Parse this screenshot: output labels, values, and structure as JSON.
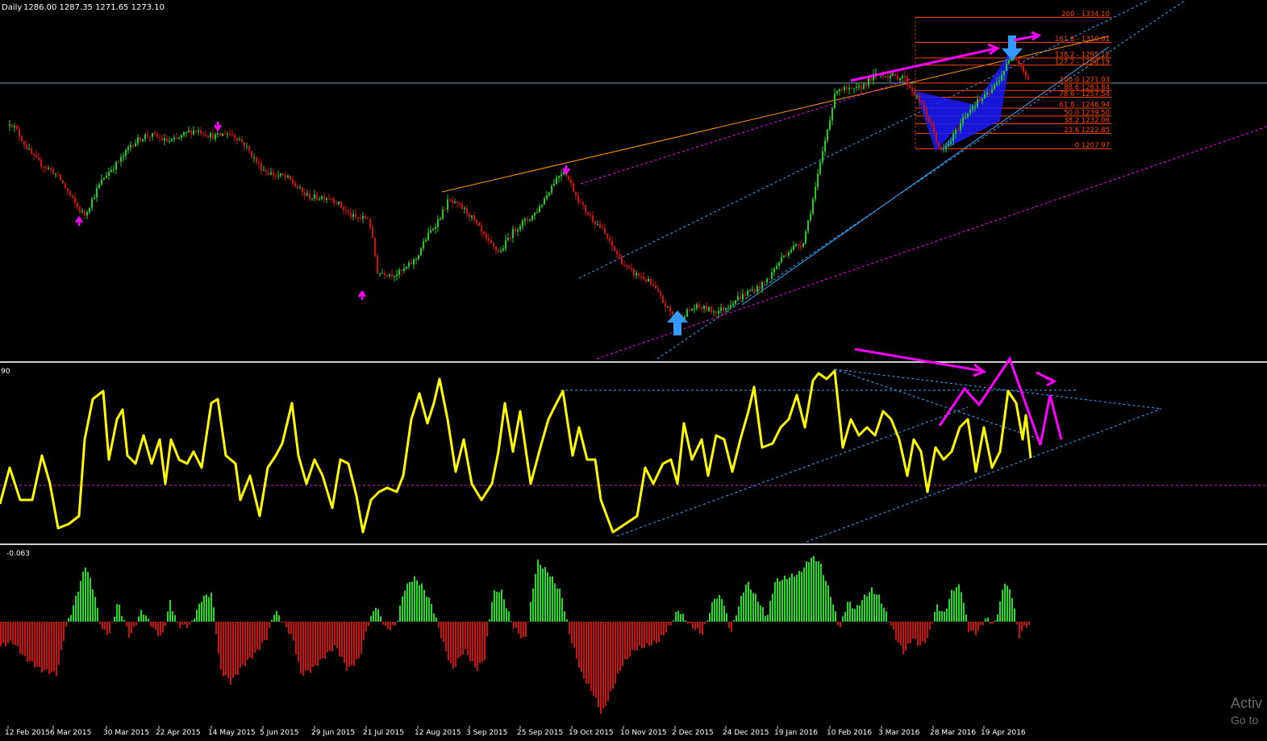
{
  "header": {
    "timeframe": "Daily",
    "ohlc": "1286.00 1287.35 1271.65 1273.10"
  },
  "oscillator_level": "90",
  "histogram_value": "-0.063",
  "x_labels": [
    "12 Feb 2015",
    "6 Mar 2015",
    "30 Mar 2015",
    "22 Apr 2015",
    "14 May 2015",
    "5 Jun 2015",
    "29 Jun 2015",
    "21 Jul 2015",
    "12 Aug 2015",
    "3 Sep 2015",
    "25 Sep 2015",
    "19 Oct 2015",
    "10 Nov 2015",
    "2 Dec 2015",
    "24 Dec 2015",
    "19 Jan 2016",
    "10 Feb 2016",
    "3 Mar 2016",
    "28 Mar 2016",
    "19 Apr 2016"
  ],
  "fib_levels": [
    {
      "label": "200 - 1334.10",
      "value": 1334.1
    },
    {
      "label": "161.8 - 1310.01",
      "value": 1310.01
    },
    {
      "label": "138.2 - 1295.12",
      "value": 1295.12
    },
    {
      "label": "127.2 - 1288.19",
      "value": 1288.19
    },
    {
      "label": "100.0 1271.03",
      "value": 1271.03
    },
    {
      "label": "88.6 1263.84",
      "value": 1263.84
    },
    {
      "label": "78.6 - 1257.54",
      "value": 1257.54
    },
    {
      "label": "61.8 - 1246.94",
      "value": 1246.94
    },
    {
      "label": "50.0 1239.50",
      "value": 1239.5
    },
    {
      "label": "38.2 1232.06",
      "value": 1232.06
    },
    {
      "label": "23.6 1222.85",
      "value": 1222.85
    },
    {
      "label": "0 1207.97",
      "value": 1207.97
    }
  ],
  "colors": {
    "background": "#000000",
    "bull": "#22cc22",
    "bear": "#cc1111",
    "oscillator": "#ffff00",
    "arrows": "#ff00ff",
    "fib": "#ff4400",
    "trend": "#ff9900",
    "channel": "#33aaff",
    "pattern": "#1a1aff",
    "hist_up": "#22dd22",
    "hist_down": "#cc1111",
    "signal": "#3399ff"
  },
  "chart_data": {
    "type": "line",
    "instrument_timeframe": "Daily",
    "price_anchors": [
      {
        "date": "2015-02-12",
        "price": 1230
      },
      {
        "date": "2015-03-17",
        "price": 1148
      },
      {
        "date": "2015-04-06",
        "price": 1215
      },
      {
        "date": "2015-05-18",
        "price": 1225
      },
      {
        "date": "2015-06-10",
        "price": 1180
      },
      {
        "date": "2015-07-20",
        "price": 1140
      },
      {
        "date": "2015-07-24",
        "price": 1085
      },
      {
        "date": "2015-08-10",
        "price": 1100
      },
      {
        "date": "2015-08-24",
        "price": 1162
      },
      {
        "date": "2015-09-16",
        "price": 1110
      },
      {
        "date": "2015-10-14",
        "price": 1185
      },
      {
        "date": "2015-11-03",
        "price": 1115
      },
      {
        "date": "2015-12-03",
        "price": 1048
      },
      {
        "date": "2015-12-31",
        "price": 1062
      },
      {
        "date": "2016-01-27",
        "price": 1120
      },
      {
        "date": "2016-02-11",
        "price": 1263
      },
      {
        "date": "2016-03-11",
        "price": 1282
      },
      {
        "date": "2016-03-28",
        "price": 1208
      },
      {
        "date": "2016-04-29",
        "price": 1295
      },
      {
        "date": "2016-05-06",
        "price": 1273
      }
    ],
    "fibonacci_levels": [
      1334.1,
      1310.01,
      1295.12,
      1288.19,
      1271.03,
      1263.84,
      1257.54,
      1246.94,
      1239.5,
      1232.06,
      1222.85,
      1207.97
    ],
    "current_price_line": 1271.03
  }
}
